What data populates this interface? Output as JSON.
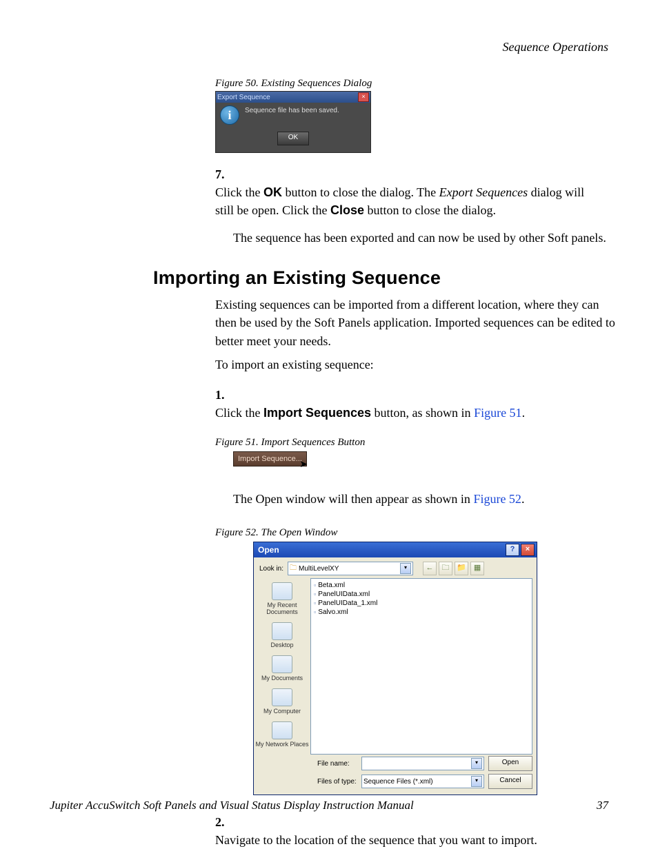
{
  "running_head": "Sequence Operations",
  "fig50": {
    "caption": "Figure 50.  Existing Sequences Dialog",
    "title": "Export Sequence",
    "close_glyph": "×",
    "info_glyph": "i",
    "message": "Sequence file has been saved.",
    "ok_label": "OK"
  },
  "step7": {
    "num": "7.",
    "pre": "Click the ",
    "ok": "OK",
    "mid1": " button to close the dialog. The ",
    "ital1": "Export Sequences",
    "mid2": " dialog will still be open. Click the ",
    "close": "Close",
    "post": " button to close the dialog."
  },
  "para_exported": "The sequence has been exported and can now be used by other Soft panels.",
  "h2": "Importing an Existing Sequence",
  "intro1": "Existing sequences can be imported from a different location, where they can then be used by the Soft Panels application. Imported sequences can be edited to better meet your needs.",
  "intro2": "To import an existing sequence:",
  "step1": {
    "num": "1.",
    "pre": "Click the ",
    "bold": "Import Sequences",
    "mid": " button, as shown in ",
    "link": "Figure 51",
    "post": "."
  },
  "fig51": {
    "caption": "Figure 51.  Import Sequences Button",
    "button_label": "Import Sequence...",
    "cursor_glyph": "➤"
  },
  "open_line": {
    "pre": "The ",
    "ital": "Open",
    "mid": " window will then appear as shown in ",
    "link": "Figure 52",
    "post": "."
  },
  "fig52": {
    "caption": "Figure 52.  The Open Window",
    "title": "Open",
    "help_glyph": "?",
    "close_glyph": "×",
    "lookin_label": "Look in:",
    "folder_glyph": "🗀",
    "lookin_value": "MultiLevelXY",
    "dd_glyph": "▾",
    "nav": {
      "back": "←",
      "up": "🗀",
      "new": "📁",
      "view": "▦"
    },
    "places": [
      {
        "label": "My Recent Documents"
      },
      {
        "label": "Desktop"
      },
      {
        "label": "My Documents"
      },
      {
        "label": "My Computer"
      },
      {
        "label": "My Network Places"
      }
    ],
    "files": [
      "Beta.xml",
      "PanelUIData.xml",
      "PanelUIData_1.xml",
      "Salvo.xml"
    ],
    "filename_label": "File name:",
    "filename_value": "",
    "filetype_label": "Files of type:",
    "filetype_value": "Sequence Files (*.xml)",
    "open_btn": "Open",
    "cancel_btn": "Cancel"
  },
  "step2": {
    "num": "2.",
    "text": "Navigate to the location of the sequence that you want to import."
  },
  "footer": {
    "title": "Jupiter AccuSwitch Soft Panels and Visual Status Display Instruction Manual",
    "page": "37"
  }
}
